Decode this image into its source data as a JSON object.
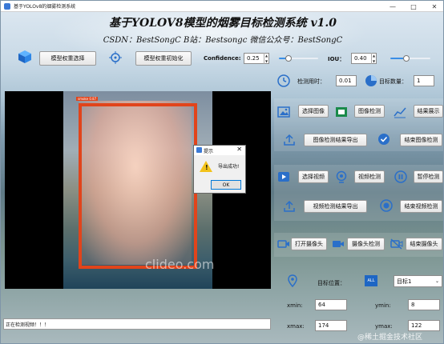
{
  "window": {
    "title": "基于YOLOv8的烟雾检测系统"
  },
  "header": {
    "title": "基于YOLOV8模型的烟雾目标检测系统 v1.0",
    "subtitle": "CSDN：BestSongC   B站：Bestsongc   微信公众号：BestSongC"
  },
  "toolbar": {
    "model_select": "模型权重选择",
    "model_init": "模型权重初始化",
    "confidence_label": "Confidence:",
    "confidence_value": "0.25",
    "confidence_level": 0.25,
    "iou_label": "IOU：",
    "iou_value": "0.40",
    "iou_level": 0.4
  },
  "stats": {
    "time_label": "检测用时：",
    "time_value": "0.01",
    "count_label": "目标数量：",
    "count_value": "1"
  },
  "image_section": {
    "select": "选择图像",
    "detect": "图像检测",
    "show": "结果展示",
    "export": "图像检测结果导出",
    "finish": "结束图像检测"
  },
  "video_section": {
    "select": "选择视频",
    "detect": "视频检测",
    "pause": "暂停检测",
    "export": "视频检测结果导出",
    "finish": "结束视频检测"
  },
  "camera_section": {
    "open": "打开摄像头",
    "detect": "摄像头检测",
    "close": "结束摄像头"
  },
  "target": {
    "position_label": "目标位置：",
    "all_badge": "ALL",
    "selected": "目标1",
    "xmin_label": "xmin:",
    "xmin_value": "64",
    "ymin_label": "ymin:",
    "ymin_value": "8",
    "xmax_label": "xmax:",
    "xmax_value": "174",
    "ymax_label": "ymax:",
    "ymax_value": "122"
  },
  "video": {
    "watermark": "clideo.com",
    "box_label": "smoke 0.87"
  },
  "dialog": {
    "title": "提示",
    "message": "导出成功!",
    "ok": "OK"
  },
  "status": {
    "text": "正在检测视频！！！"
  },
  "watermark": "@稀土掘金技术社区",
  "colors": {
    "accent": "#3a8ee6",
    "bbox": "#e1441b",
    "icon_blue": "#2a6fc9"
  }
}
